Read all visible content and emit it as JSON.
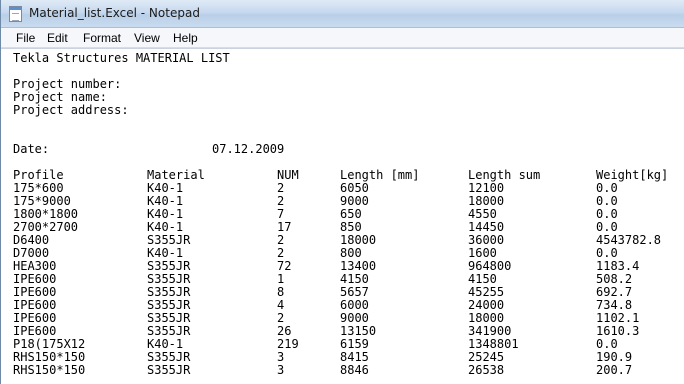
{
  "window": {
    "title": "Material_list.Excel - Notepad"
  },
  "menu": {
    "items": [
      "File",
      "Edit",
      "Format",
      "View",
      "Help"
    ]
  },
  "doc": {
    "heading": "Tekla Structures MATERIAL LIST",
    "project_number_label": "Project number:",
    "project_name_label": "Project name:",
    "project_address_label": "Project address:",
    "date_label": "Date:",
    "date_value": "07.12.2009",
    "columns": [
      "Profile",
      "Material",
      "NUM",
      "Length [mm]",
      "Length sum",
      "Weight[kg]"
    ],
    "rows": [
      [
        "175*600",
        "K40-1",
        "2",
        "6050",
        "12100",
        "0.0"
      ],
      [
        "175*9000",
        "K40-1",
        "2",
        "9000",
        "18000",
        "0.0"
      ],
      [
        "1800*1800",
        "K40-1",
        "7",
        "650",
        "4550",
        "0.0"
      ],
      [
        "2700*2700",
        "K40-1",
        "17",
        "850",
        "14450",
        "0.0"
      ],
      [
        "D6400",
        "S355JR",
        "2",
        "18000",
        "36000",
        "4543782.8"
      ],
      [
        "D7000",
        "K40-1",
        "2",
        "800",
        "1600",
        "0.0"
      ],
      [
        "HEA300",
        "S355JR",
        "72",
        "13400",
        "964800",
        "1183.4"
      ],
      [
        "IPE600",
        "S355JR",
        "1",
        "4150",
        "4150",
        "508.2"
      ],
      [
        "IPE600",
        "S355JR",
        "8",
        "5657",
        "45255",
        "692.7"
      ],
      [
        "IPE600",
        "S355JR",
        "4",
        "6000",
        "24000",
        "734.8"
      ],
      [
        "IPE600",
        "S355JR",
        "2",
        "9000",
        "18000",
        "1102.1"
      ],
      [
        "IPE600",
        "S355JR",
        "26",
        "13150",
        "341900",
        "1610.3"
      ],
      [
        "P18(175X12",
        "K40-1",
        "219",
        "6159",
        "1348801",
        "0.0"
      ],
      [
        "RHS150*150",
        "S355JR",
        "3",
        "8415",
        "25245",
        "190.9"
      ],
      [
        "RHS150*150",
        "S355JR",
        "3",
        "8846",
        "26538",
        "200.7"
      ]
    ]
  }
}
